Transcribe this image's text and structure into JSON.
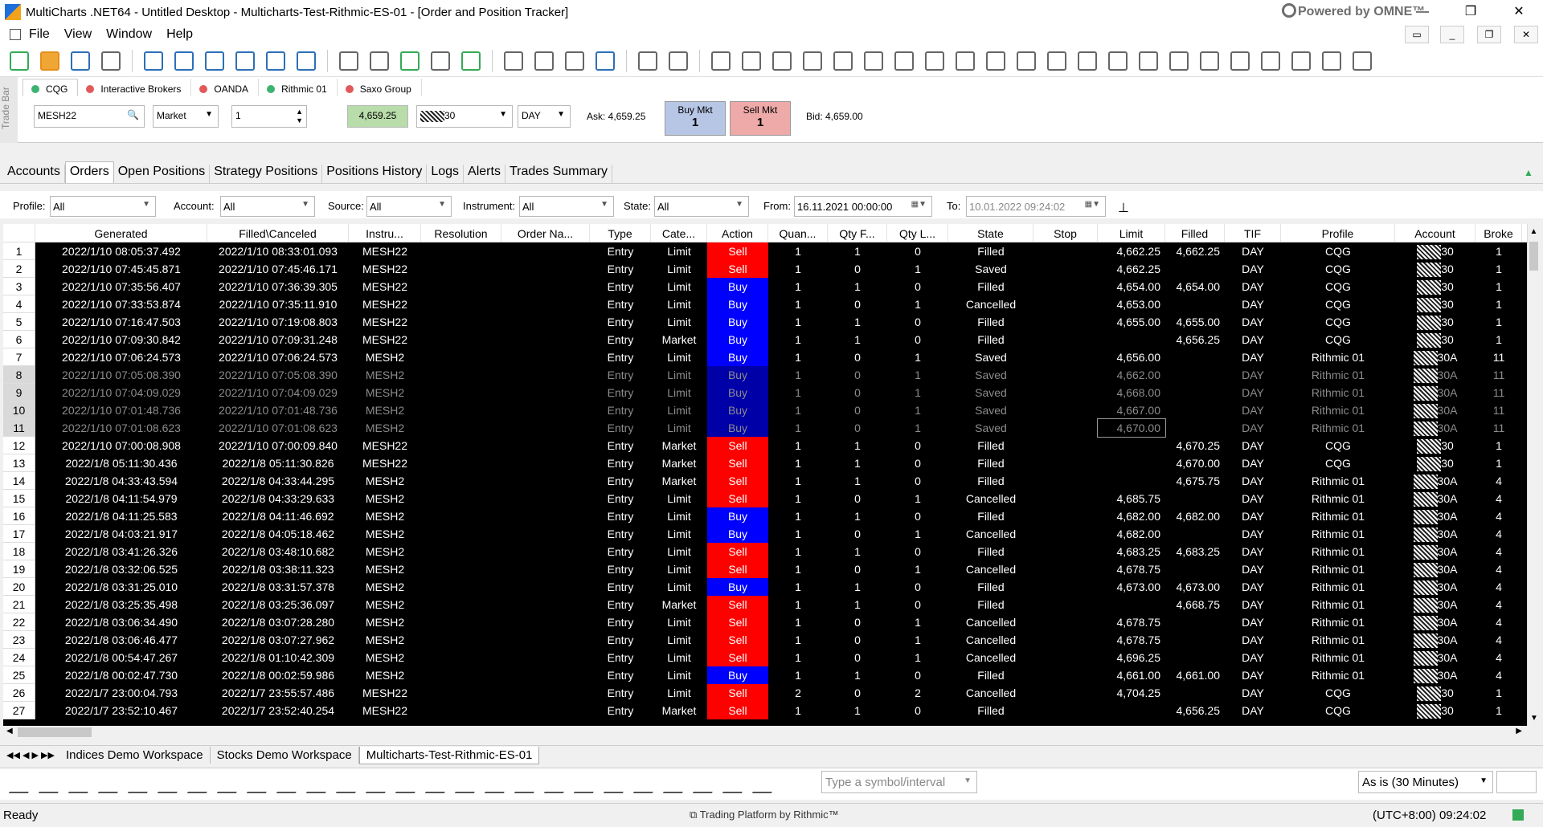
{
  "window": {
    "title": "MultiCharts .NET64 - Untitled Desktop - Multicharts-Test-Rithmic-ES-01 - [Order and Position Tracker]",
    "brand": "Powered by OMNE™"
  },
  "menu": [
    "File",
    "View",
    "Window",
    "Help"
  ],
  "tradebar": {
    "label": "Trade Bar",
    "brokers": [
      {
        "name": "CQG",
        "color": "#3cb371"
      },
      {
        "name": "Interactive Brokers",
        "color": "#e05a5a"
      },
      {
        "name": "OANDA",
        "color": "#e05a5a"
      },
      {
        "name": "Rithmic 01",
        "color": "#3cb371"
      },
      {
        "name": "Saxo Group",
        "color": "#e05a5a"
      }
    ],
    "symbol": "MESH22",
    "order_type": "Market",
    "quantity": "1",
    "price": "4,659.25",
    "account_suffix": "30",
    "tif": "DAY",
    "ask": "Ask: 4,659.25",
    "bid": "Bid: 4,659.00",
    "buy_label": "Buy Mkt",
    "buy_qty": "1",
    "sell_label": "Sell Mkt",
    "sell_qty": "1"
  },
  "tabs": [
    "Accounts",
    "Orders",
    "Open Positions",
    "Strategy Positions",
    "Positions History",
    "Logs",
    "Alerts",
    "Trades Summary"
  ],
  "filters": {
    "profile_label": "Profile:",
    "profile": "All",
    "account_label": "Account:",
    "account": "All",
    "source_label": "Source:",
    "source": "All",
    "instrument_label": "Instrument:",
    "instrument": "All",
    "state_label": "State:",
    "state": "All",
    "from_label": "From:",
    "from": "16.11.2021 00:00:00",
    "to_label": "To:",
    "to": "10.01.2022 09:24:02"
  },
  "columns": [
    "Generated",
    "Filled\\Canceled",
    "Instru...",
    "Resolution",
    "Order Na...",
    "Type",
    "Cate...",
    "Action",
    "Quan...",
    "Qty F...",
    "Qty L...",
    "State",
    "Stop",
    "Limit",
    "Filled",
    "TIF",
    "Profile",
    "Account",
    "Broke"
  ],
  "orders": [
    {
      "n": "1",
      "gen": "2022/1/10 08:05:37.492",
      "fc": "2022/1/10 08:33:01.093",
      "ins": "MESH22",
      "type": "Entry",
      "cat": "Limit",
      "action": "Sell",
      "q": "1",
      "qf": "1",
      "ql": "0",
      "state": "Filled",
      "limit": "4,662.25",
      "filled": "4,662.25",
      "tif": "DAY",
      "profile": "CQG",
      "acct": "30",
      "brk": "1"
    },
    {
      "n": "2",
      "gen": "2022/1/10 07:45:45.871",
      "fc": "2022/1/10 07:45:46.171",
      "ins": "MESH22",
      "type": "Entry",
      "cat": "Limit",
      "action": "Sell",
      "q": "1",
      "qf": "0",
      "ql": "1",
      "state": "Saved",
      "limit": "4,662.25",
      "filled": "",
      "tif": "DAY",
      "profile": "CQG",
      "acct": "30",
      "brk": "1"
    },
    {
      "n": "3",
      "gen": "2022/1/10 07:35:56.407",
      "fc": "2022/1/10 07:36:39.305",
      "ins": "MESH22",
      "type": "Entry",
      "cat": "Limit",
      "action": "Buy",
      "q": "1",
      "qf": "1",
      "ql": "0",
      "state": "Filled",
      "limit": "4,654.00",
      "filled": "4,654.00",
      "tif": "DAY",
      "profile": "CQG",
      "acct": "30",
      "brk": "1"
    },
    {
      "n": "4",
      "gen": "2022/1/10 07:33:53.874",
      "fc": "2022/1/10 07:35:11.910",
      "ins": "MESH22",
      "type": "Entry",
      "cat": "Limit",
      "action": "Buy",
      "q": "1",
      "qf": "0",
      "ql": "1",
      "state": "Cancelled",
      "limit": "4,653.00",
      "filled": "",
      "tif": "DAY",
      "profile": "CQG",
      "acct": "30",
      "brk": "1"
    },
    {
      "n": "5",
      "gen": "2022/1/10 07:16:47.503",
      "fc": "2022/1/10 07:19:08.803",
      "ins": "MESH22",
      "type": "Entry",
      "cat": "Limit",
      "action": "Buy",
      "q": "1",
      "qf": "1",
      "ql": "0",
      "state": "Filled",
      "limit": "4,655.00",
      "filled": "4,655.00",
      "tif": "DAY",
      "profile": "CQG",
      "acct": "30",
      "brk": "1"
    },
    {
      "n": "6",
      "gen": "2022/1/10 07:09:30.842",
      "fc": "2022/1/10 07:09:31.248",
      "ins": "MESH22",
      "type": "Entry",
      "cat": "Market",
      "action": "Buy",
      "q": "1",
      "qf": "1",
      "ql": "0",
      "state": "Filled",
      "limit": "",
      "filled": "4,656.25",
      "tif": "DAY",
      "profile": "CQG",
      "acct": "30",
      "brk": "1"
    },
    {
      "n": "7",
      "gen": "2022/1/10 07:06:24.573",
      "fc": "2022/1/10 07:06:24.573",
      "ins": "MESH2",
      "type": "Entry",
      "cat": "Limit",
      "action": "Buy",
      "q": "1",
      "qf": "0",
      "ql": "1",
      "state": "Saved",
      "limit": "4,656.00",
      "filled": "",
      "tif": "DAY",
      "profile": "Rithmic 01",
      "acct": "30A",
      "brk": "11"
    },
    {
      "n": "8",
      "gen": "2022/1/10 07:05:08.390",
      "fc": "2022/1/10 07:05:08.390",
      "ins": "MESH2",
      "type": "Entry",
      "cat": "Limit",
      "action": "Buy",
      "q": "1",
      "qf": "0",
      "ql": "1",
      "state": "Saved",
      "limit": "4,662.00",
      "filled": "",
      "tif": "DAY",
      "profile": "Rithmic 01",
      "acct": "30A",
      "brk": "11",
      "dim": true
    },
    {
      "n": "9",
      "gen": "2022/1/10 07:04:09.029",
      "fc": "2022/1/10 07:04:09.029",
      "ins": "MESH2",
      "type": "Entry",
      "cat": "Limit",
      "action": "Buy",
      "q": "1",
      "qf": "0",
      "ql": "1",
      "state": "Saved",
      "limit": "4,668.00",
      "filled": "",
      "tif": "DAY",
      "profile": "Rithmic 01",
      "acct": "30A",
      "brk": "11",
      "dim": true
    },
    {
      "n": "10",
      "gen": "2022/1/10 07:01:48.736",
      "fc": "2022/1/10 07:01:48.736",
      "ins": "MESH2",
      "type": "Entry",
      "cat": "Limit",
      "action": "Buy",
      "q": "1",
      "qf": "0",
      "ql": "1",
      "state": "Saved",
      "limit": "4,667.00",
      "filled": "",
      "tif": "DAY",
      "profile": "Rithmic 01",
      "acct": "30A",
      "brk": "11",
      "dim": true
    },
    {
      "n": "11",
      "gen": "2022/1/10 07:01:08.623",
      "fc": "2022/1/10 07:01:08.623",
      "ins": "MESH2",
      "type": "Entry",
      "cat": "Limit",
      "action": "Buy",
      "q": "1",
      "qf": "0",
      "ql": "1",
      "state": "Saved",
      "limit": "4,670.00",
      "filled": "",
      "tif": "DAY",
      "profile": "Rithmic 01",
      "acct": "30A",
      "brk": "11",
      "dim": true
    },
    {
      "n": "12",
      "gen": "2022/1/10 07:00:08.908",
      "fc": "2022/1/10 07:00:09.840",
      "ins": "MESH22",
      "type": "Entry",
      "cat": "Market",
      "action": "Sell",
      "q": "1",
      "qf": "1",
      "ql": "0",
      "state": "Filled",
      "limit": "",
      "filled": "4,670.25",
      "tif": "DAY",
      "profile": "CQG",
      "acct": "30",
      "brk": "1"
    },
    {
      "n": "13",
      "gen": "2022/1/8 05:11:30.436",
      "fc": "2022/1/8 05:11:30.826",
      "ins": "MESH22",
      "type": "Entry",
      "cat": "Market",
      "action": "Sell",
      "q": "1",
      "qf": "1",
      "ql": "0",
      "state": "Filled",
      "limit": "",
      "filled": "4,670.00",
      "tif": "DAY",
      "profile": "CQG",
      "acct": "30",
      "brk": "1"
    },
    {
      "n": "14",
      "gen": "2022/1/8 04:33:43.594",
      "fc": "2022/1/8 04:33:44.295",
      "ins": "MESH2",
      "type": "Entry",
      "cat": "Market",
      "action": "Sell",
      "q": "1",
      "qf": "1",
      "ql": "0",
      "state": "Filled",
      "limit": "",
      "filled": "4,675.75",
      "tif": "DAY",
      "profile": "Rithmic 01",
      "acct": "30A",
      "brk": "4"
    },
    {
      "n": "15",
      "gen": "2022/1/8 04:11:54.979",
      "fc": "2022/1/8 04:33:29.633",
      "ins": "MESH2",
      "type": "Entry",
      "cat": "Limit",
      "action": "Sell",
      "q": "1",
      "qf": "0",
      "ql": "1",
      "state": "Cancelled",
      "limit": "4,685.75",
      "filled": "",
      "tif": "DAY",
      "profile": "Rithmic 01",
      "acct": "30A",
      "brk": "4"
    },
    {
      "n": "16",
      "gen": "2022/1/8 04:11:25.583",
      "fc": "2022/1/8 04:11:46.692",
      "ins": "MESH2",
      "type": "Entry",
      "cat": "Limit",
      "action": "Buy",
      "q": "1",
      "qf": "1",
      "ql": "0",
      "state": "Filled",
      "limit": "4,682.00",
      "filled": "4,682.00",
      "tif": "DAY",
      "profile": "Rithmic 01",
      "acct": "30A",
      "brk": "4"
    },
    {
      "n": "17",
      "gen": "2022/1/8 04:03:21.917",
      "fc": "2022/1/8 04:05:18.462",
      "ins": "MESH2",
      "type": "Entry",
      "cat": "Limit",
      "action": "Buy",
      "q": "1",
      "qf": "0",
      "ql": "1",
      "state": "Cancelled",
      "limit": "4,682.00",
      "filled": "",
      "tif": "DAY",
      "profile": "Rithmic 01",
      "acct": "30A",
      "brk": "4"
    },
    {
      "n": "18",
      "gen": "2022/1/8 03:41:26.326",
      "fc": "2022/1/8 03:48:10.682",
      "ins": "MESH2",
      "type": "Entry",
      "cat": "Limit",
      "action": "Sell",
      "q": "1",
      "qf": "1",
      "ql": "0",
      "state": "Filled",
      "limit": "4,683.25",
      "filled": "4,683.25",
      "tif": "DAY",
      "profile": "Rithmic 01",
      "acct": "30A",
      "brk": "4"
    },
    {
      "n": "19",
      "gen": "2022/1/8 03:32:06.525",
      "fc": "2022/1/8 03:38:11.323",
      "ins": "MESH2",
      "type": "Entry",
      "cat": "Limit",
      "action": "Sell",
      "q": "1",
      "qf": "0",
      "ql": "1",
      "state": "Cancelled",
      "limit": "4,678.75",
      "filled": "",
      "tif": "DAY",
      "profile": "Rithmic 01",
      "acct": "30A",
      "brk": "4"
    },
    {
      "n": "20",
      "gen": "2022/1/8 03:31:25.010",
      "fc": "2022/1/8 03:31:57.378",
      "ins": "MESH2",
      "type": "Entry",
      "cat": "Limit",
      "action": "Buy",
      "q": "1",
      "qf": "1",
      "ql": "0",
      "state": "Filled",
      "limit": "4,673.00",
      "filled": "4,673.00",
      "tif": "DAY",
      "profile": "Rithmic 01",
      "acct": "30A",
      "brk": "4"
    },
    {
      "n": "21",
      "gen": "2022/1/8 03:25:35.498",
      "fc": "2022/1/8 03:25:36.097",
      "ins": "MESH2",
      "type": "Entry",
      "cat": "Market",
      "action": "Sell",
      "q": "1",
      "qf": "1",
      "ql": "0",
      "state": "Filled",
      "limit": "",
      "filled": "4,668.75",
      "tif": "DAY",
      "profile": "Rithmic 01",
      "acct": "30A",
      "brk": "4"
    },
    {
      "n": "22",
      "gen": "2022/1/8 03:06:34.490",
      "fc": "2022/1/8 03:07:28.280",
      "ins": "MESH2",
      "type": "Entry",
      "cat": "Limit",
      "action": "Sell",
      "q": "1",
      "qf": "0",
      "ql": "1",
      "state": "Cancelled",
      "limit": "4,678.75",
      "filled": "",
      "tif": "DAY",
      "profile": "Rithmic 01",
      "acct": "30A",
      "brk": "4"
    },
    {
      "n": "23",
      "gen": "2022/1/8 03:06:46.477",
      "fc": "2022/1/8 03:07:27.962",
      "ins": "MESH2",
      "type": "Entry",
      "cat": "Limit",
      "action": "Sell",
      "q": "1",
      "qf": "0",
      "ql": "1",
      "state": "Cancelled",
      "limit": "4,678.75",
      "filled": "",
      "tif": "DAY",
      "profile": "Rithmic 01",
      "acct": "30A",
      "brk": "4"
    },
    {
      "n": "24",
      "gen": "2022/1/8 00:54:47.267",
      "fc": "2022/1/8 01:10:42.309",
      "ins": "MESH2",
      "type": "Entry",
      "cat": "Limit",
      "action": "Sell",
      "q": "1",
      "qf": "0",
      "ql": "1",
      "state": "Cancelled",
      "limit": "4,696.25",
      "filled": "",
      "tif": "DAY",
      "profile": "Rithmic 01",
      "acct": "30A",
      "brk": "4"
    },
    {
      "n": "25",
      "gen": "2022/1/8 00:02:47.730",
      "fc": "2022/1/8 00:02:59.986",
      "ins": "MESH2",
      "type": "Entry",
      "cat": "Limit",
      "action": "Buy",
      "q": "1",
      "qf": "1",
      "ql": "0",
      "state": "Filled",
      "limit": "4,661.00",
      "filled": "4,661.00",
      "tif": "DAY",
      "profile": "Rithmic 01",
      "acct": "30A",
      "brk": "4"
    },
    {
      "n": "26",
      "gen": "2022/1/7 23:00:04.793",
      "fc": "2022/1/7 23:55:57.486",
      "ins": "MESH22",
      "type": "Entry",
      "cat": "Limit",
      "action": "Sell",
      "q": "2",
      "qf": "0",
      "ql": "2",
      "state": "Cancelled",
      "limit": "4,704.25",
      "filled": "",
      "tif": "DAY",
      "profile": "CQG",
      "acct": "30",
      "brk": "1"
    },
    {
      "n": "27",
      "gen": "2022/1/7 23:52:10.467",
      "fc": "2022/1/7 23:52:40.254",
      "ins": "MESH22",
      "type": "Entry",
      "cat": "Market",
      "action": "Sell",
      "q": "1",
      "qf": "1",
      "ql": "0",
      "state": "Filled",
      "limit": "",
      "filled": "4,656.25",
      "tif": "DAY",
      "profile": "CQG",
      "acct": "30",
      "brk": "1"
    }
  ],
  "workspaces": [
    "Indices Demo Workspace",
    "Stocks Demo Workspace",
    "Multicharts-Test-Rithmic-ES-01"
  ],
  "drawbar": {
    "symbol_placeholder": "Type a symbol/interval",
    "interval": "As is (30 Minutes)"
  },
  "status": {
    "left": "Ready",
    "center": "Trading Platform by Rithmic™",
    "right": "(UTC+8:00) 09:24:02"
  }
}
